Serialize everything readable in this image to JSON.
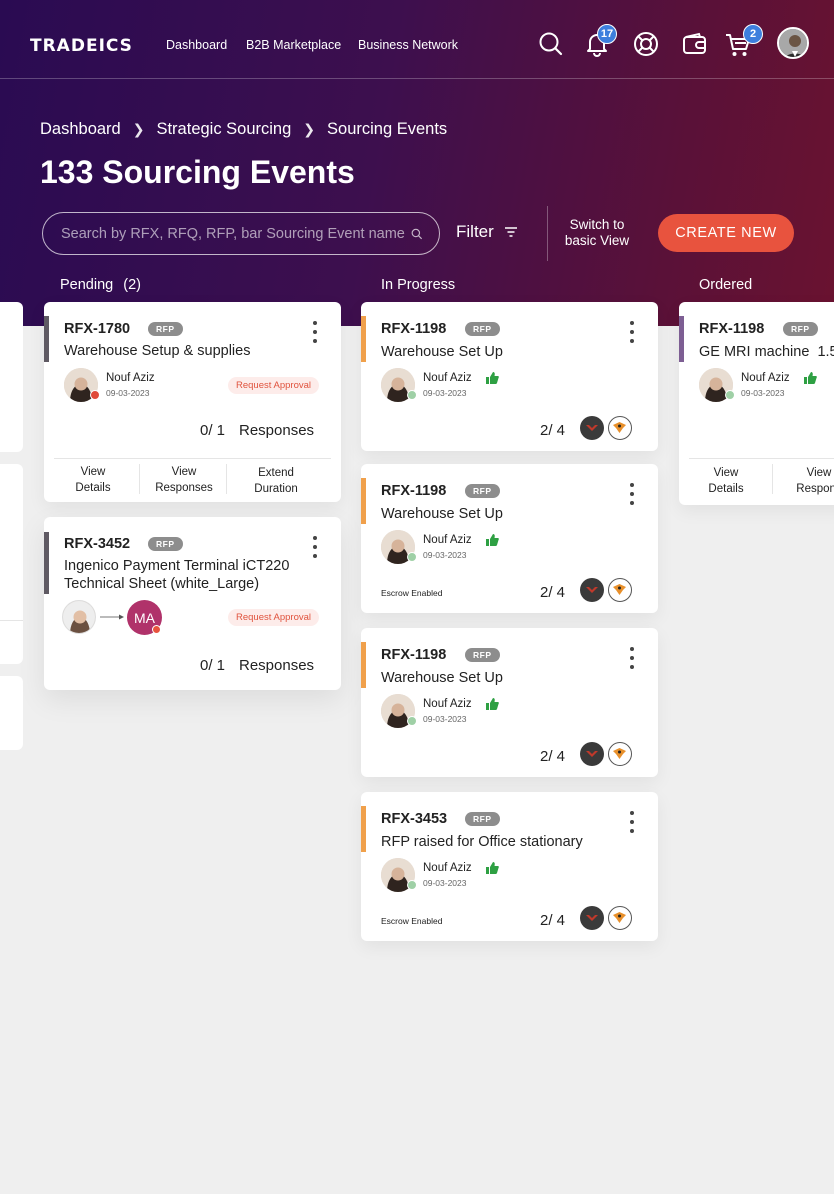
{
  "header": {
    "logo": "TRADEICS",
    "nav": [
      "Dashboard",
      "B2B Marketplace",
      "Business Network"
    ],
    "notifications_count": "17",
    "cart_count": "2",
    "icons": [
      "search-icon",
      "bell-icon",
      "support-icon",
      "wallet-icon",
      "cart-icon"
    ]
  },
  "breadcrumb": [
    "Dashboard",
    "Strategic Sourcing",
    "Sourcing Events"
  ],
  "page_title": "133 Sourcing Events",
  "toolbar": {
    "search_placeholder": "Search by RFX, RFQ, RFP, bar Sourcing Event name",
    "filter_label": "Filter",
    "switch_view_label": "Switch to basic View",
    "create_label": "CREATE NEW"
  },
  "columns": {
    "pending": {
      "label": "Pending",
      "count": "(2)",
      "cards": [
        {
          "rfx": "RFX-1780",
          "tag": "RFP",
          "title": "Warehouse Setup & supplies",
          "person": "Nouf Aziz",
          "date": "09-03-2023",
          "status": "Request Approval",
          "responses_count": "0/ 1",
          "responses_label": "Responses",
          "actions": [
            "View Details",
            "View Responses",
            "Extend Duration"
          ]
        },
        {
          "rfx": "RFX-3452",
          "tag": "RFP",
          "title_line1": "Ingenico Payment Terminal iCT220",
          "title_line2": "Technical Sheet (white_Large)",
          "assignee_initials": "MA",
          "status": "Request Approval",
          "responses_count": "0/ 1",
          "responses_label": "Responses"
        }
      ]
    },
    "in_progress": {
      "label": "In Progress",
      "cards": [
        {
          "rfx": "RFX-1198",
          "tag": "RFP",
          "title": "Warehouse Set Up",
          "person": "Nouf Aziz",
          "date": "09-03-2023",
          "escrow": "",
          "count": "2/ 4"
        },
        {
          "rfx": "RFX-1198",
          "tag": "RFP",
          "title": "Warehouse Set Up",
          "person": "Nouf Aziz",
          "date": "09-03-2023",
          "escrow": "Escrow Enabled",
          "count": "2/ 4"
        },
        {
          "rfx": "RFX-1198",
          "tag": "RFP",
          "title": "Warehouse Set Up",
          "person": "Nouf Aziz",
          "date": "09-03-2023",
          "escrow": "",
          "count": "2/ 4"
        },
        {
          "rfx": "RFX-3453",
          "tag": "RFP",
          "title": "RFP raised for Office stationary",
          "person": "Nouf Aziz",
          "date": "09-03-2023",
          "escrow": "Escrow Enabled",
          "count": "2/ 4"
        }
      ]
    },
    "ordered": {
      "label": "Ordered",
      "cards": [
        {
          "rfx": "RFX-1198",
          "tag": "RFP",
          "title": "GE MRI machine  1.5",
          "person": "Nouf Aziz",
          "date": "09-03-2023",
          "actions": [
            "View Details",
            "View Respons"
          ]
        }
      ]
    }
  },
  "colors": {
    "accent": "#e8533e",
    "pending_bar": "#5f5a63",
    "in_progress_bar": "#f0a04b",
    "ordered_bar": "#7d5e93",
    "badge": "#3d7fdd"
  }
}
